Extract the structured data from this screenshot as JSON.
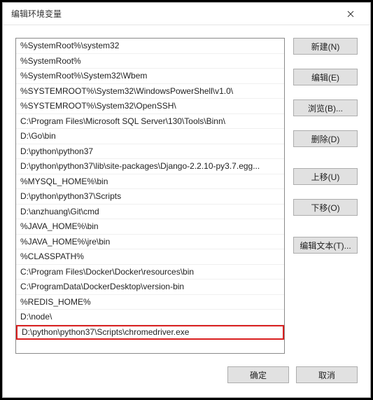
{
  "window": {
    "title": "编辑环境变量"
  },
  "list": {
    "items": [
      "%SystemRoot%\\system32",
      "%SystemRoot%",
      "%SystemRoot%\\System32\\Wbem",
      "%SYSTEMROOT%\\System32\\WindowsPowerShell\\v1.0\\",
      "%SYSTEMROOT%\\System32\\OpenSSH\\",
      "C:\\Program Files\\Microsoft SQL Server\\130\\Tools\\Binn\\",
      "D:\\Go\\bin",
      "D:\\python\\python37",
      "D:\\python\\python37\\lib\\site-packages\\Django-2.2.10-py3.7.egg...",
      "%MYSQL_HOME%\\bin",
      "D:\\python\\python37\\Scripts",
      "D:\\anzhuang\\Git\\cmd",
      "%JAVA_HOME%\\bin",
      "%JAVA_HOME%\\jre\\bin",
      "%CLASSPATH%",
      "C:\\Program Files\\Docker\\Docker\\resources\\bin",
      "C:\\ProgramData\\DockerDesktop\\version-bin",
      "%REDIS_HOME%",
      "D:\\node\\",
      "D:\\python\\python37\\Scripts\\chromedriver.exe"
    ],
    "highlightIndex": 19
  },
  "buttons": {
    "new": "新建(N)",
    "edit": "编辑(E)",
    "browse": "浏览(B)...",
    "delete": "删除(D)",
    "moveUp": "上移(U)",
    "moveDown": "下移(O)",
    "editText": "编辑文本(T)...",
    "ok": "确定",
    "cancel": "取消"
  }
}
